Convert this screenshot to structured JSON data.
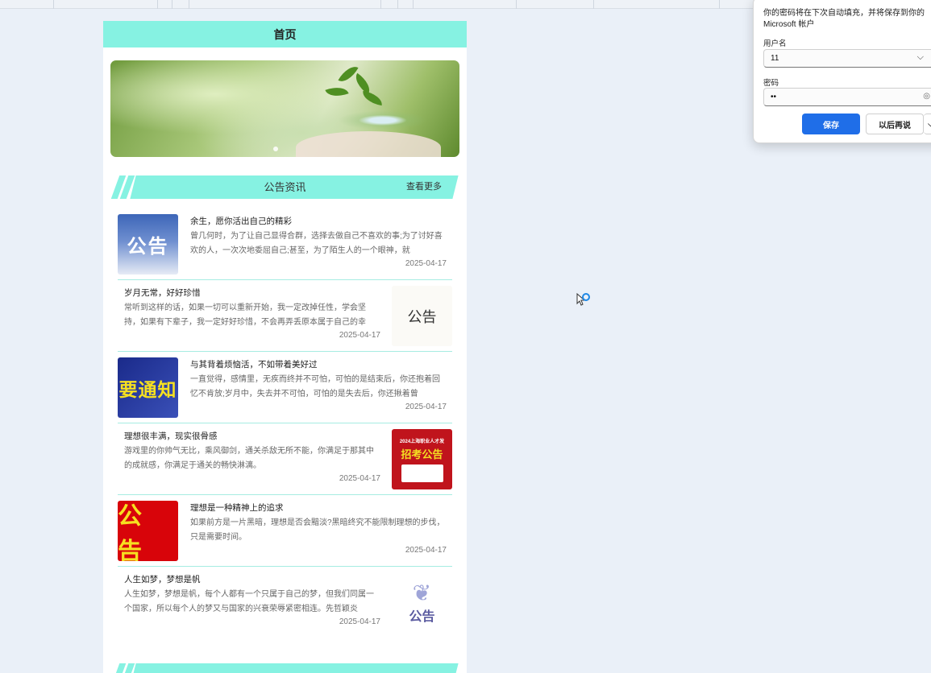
{
  "page": {
    "title": "首页"
  },
  "section": {
    "title": "公告资讯",
    "more": "查看更多"
  },
  "section2": {
    "title": "",
    "more": ""
  },
  "notices": [
    {
      "title": "余生，愿你活出自己的精彩",
      "summary": "曾几何时，为了让自己显得合群，选择去做自己不喜欢的事;为了讨好喜欢的人，一次次地委屈自己;甚至，为了陌生人的一个眼神，就",
      "date": "2025-04-17",
      "thumb_text": "公告"
    },
    {
      "title": "岁月无常，好好珍惜",
      "summary": "常听到这样的话，如果一切可以重新开始，我一定改掉任性，学会坚持，如果有下辈子，我一定好好珍惜，不会再弄丢原本属于自己的幸",
      "date": "2025-04-17",
      "thumb_text": "公告"
    },
    {
      "title": "与其背着烦恼活，不如带着美好过",
      "summary": "一直觉得，感情里，无疾而终并不可怕，可怕的是结束后，你还抱着回忆不肯放;岁月中，失去并不可怕，可怕的是失去后，你还揪着曾",
      "date": "2025-04-17",
      "thumb_text": "要通知"
    },
    {
      "title": "理想很丰满，现实很骨感",
      "summary": "游戏里的你帅气无比，乘风御剑，通关杀敌无所不能，你满足于那其中的成就感，你满足于通关的畅快淋漓。",
      "date": "2025-04-17",
      "thumb_text": "招考公告",
      "thumb_small": "2024上海职业人才发"
    },
    {
      "title": "理想是一种精神上的追求",
      "summary": "如果前方是一片黑暗，理想是否会黯淡?黑暗终究不能限制理想的步伐，只是需要时间。",
      "date": "2025-04-17",
      "thumb_text": "公 告"
    },
    {
      "title": "人生如梦，梦想是帆",
      "summary": "人生如梦，梦想是帆，每个人都有一个只属于自己的梦，但我们同属一个国家，所以每个人的梦又与国家的兴衰荣辱紧密相连。先哲颖炎",
      "date": "2025-04-17",
      "thumb_text": "公告"
    }
  ],
  "password_dialog": {
    "message": "你的密码将在下次自动填充，并将保存到你的 Microsoft 帐户",
    "username_label": "用户名",
    "username_value": "11",
    "password_label": "密码",
    "password_value": "••",
    "save_label": "保存",
    "later_label": "以后再说"
  },
  "colors": {
    "accent": "#86f2e2",
    "save_button": "#1f6ee8"
  }
}
